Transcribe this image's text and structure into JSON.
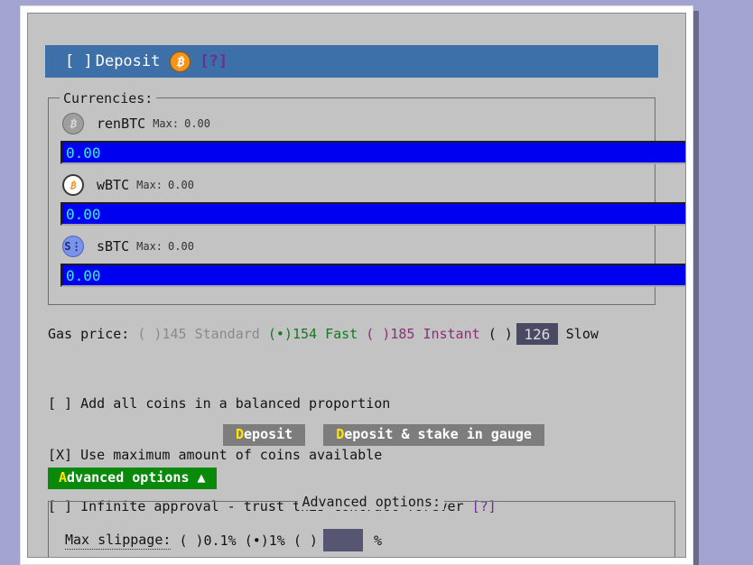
{
  "window": {
    "header": {
      "checkbox": "[ ]",
      "title": "Deposit",
      "coin_icon": "bitcoin-icon",
      "help": "[?]"
    }
  },
  "currencies": {
    "legend": "Currencies:",
    "rows": [
      {
        "icon": "renbtc-icon",
        "name": "renBTC",
        "max_label": "Max:",
        "max_value": "0.00",
        "amount": "0.00"
      },
      {
        "icon": "wbtc-icon",
        "name": "wBTC",
        "max_label": "Max:",
        "max_value": "0.00",
        "amount": "0.00"
      },
      {
        "icon": "sbtc-icon",
        "name": "sBTC",
        "max_label": "Max:",
        "max_value": "0.00",
        "amount": "0.00"
      }
    ]
  },
  "gas": {
    "label": "Gas price:",
    "options": [
      {
        "radio": "( )",
        "value": "145",
        "name": "Standard",
        "selected": false,
        "color": "#8a8a8a"
      },
      {
        "radio": "(•)",
        "value": "154",
        "name": "Fast",
        "selected": true,
        "color": "#127a20"
      },
      {
        "radio": "( )",
        "value": "185",
        "name": "Instant",
        "selected": false,
        "color": "#8a2f7a"
      },
      {
        "radio": "( )",
        "value": "126",
        "name": "Slow",
        "selected": false,
        "color": "#141414"
      }
    ],
    "custom_value": "126"
  },
  "checkboxes": [
    {
      "box": "[ ]",
      "label": "Add all coins in a balanced proportion",
      "checked": false,
      "help": ""
    },
    {
      "box": "[X]",
      "label": "Use maximum amount of coins available",
      "checked": true,
      "help": ""
    },
    {
      "box": "[ ]",
      "label": "Infinite approval - trust this contract forever",
      "checked": false,
      "help": "[?]"
    }
  ],
  "actions": {
    "deposit": {
      "accel": "D",
      "rest": "eposit"
    },
    "deposit_stake": {
      "accel": "D",
      "rest": "eposit & stake in gauge"
    }
  },
  "advanced_toggle": {
    "accel": "A",
    "rest": "dvanced options",
    "arrow": "▲"
  },
  "advanced": {
    "legend": "Advanced options:",
    "slippage": {
      "label": "Max slippage:",
      "options": [
        {
          "radio": "( )",
          "value": "0.1%",
          "selected": false
        },
        {
          "radio": "(•)",
          "value": "1%",
          "selected": true
        },
        {
          "radio": "( )",
          "value": "",
          "selected": false
        }
      ],
      "custom_value": "",
      "unit": "%"
    }
  },
  "colors": {
    "desktop_bg": "#a3a3d1",
    "window_bg": "#c3c3c3",
    "header_bg": "#3d6fa8",
    "input_bg": "#0000f0",
    "input_text": "#33f0f0",
    "accent_green": "#0a8a0a",
    "accel_yellow": "#ffe500",
    "help_purple": "#6b2f8f"
  }
}
